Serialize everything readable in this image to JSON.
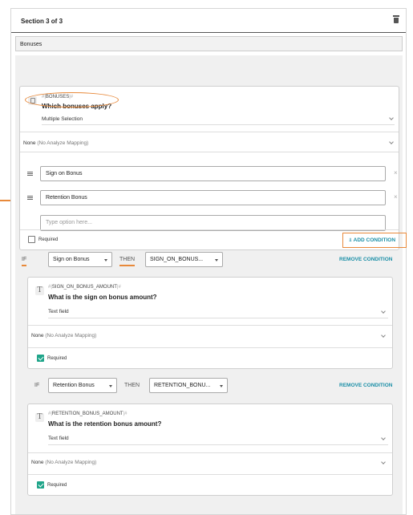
{
  "header": {
    "title": "Section 3 of 3",
    "delete_icon": "trash-icon"
  },
  "section_name": "Bonuses",
  "question1": {
    "icon": "checkbox-question-icon",
    "var_prefix": "#|",
    "var_name": "BONUSES",
    "var_suffix": "|#",
    "text": "Which bonuses apply?",
    "type": "Multiple Selection",
    "mapping_value": "None",
    "mapping_note": "(No Analyze Mapping)",
    "options": [
      "Sign on Bonus",
      "Retention Bonus"
    ],
    "new_option_placeholder": "Type option here...",
    "remove_icon": "×",
    "required_label": "Required",
    "add_condition_label": "ADD CONDITION"
  },
  "conditions": [
    {
      "if_label": "IF",
      "if_value": "Sign on Bonus",
      "then_label": "THEN",
      "then_value": "SIGN_ON_BONUS...",
      "remove_label": "REMOVE CONDITION",
      "question": {
        "icon": "text-question-icon",
        "var_prefix": "#|",
        "var_name": "SIGN_ON_BONUS_AMOUNT",
        "var_suffix": "|#",
        "text": "What is the sign on bonus amount?",
        "type": "Text field",
        "mapping_value": "None",
        "mapping_note": "(No Analyze Mapping)",
        "required_label": "Required",
        "required": true
      }
    },
    {
      "if_label": "IF",
      "if_value": "Retention Bonus",
      "then_label": "THEN",
      "then_value": "RETENTION_BONU...",
      "remove_label": "REMOVE CONDITION",
      "question": {
        "icon": "text-question-icon",
        "var_prefix": "#|",
        "var_name": "RETENTION_BONUS_AMOUNT",
        "var_suffix": "|#",
        "text": "What is the retention bonus amount?",
        "type": "Text field",
        "mapping_value": "None",
        "mapping_note": "(No Analyze Mapping)",
        "required_label": "Required",
        "required": true
      }
    }
  ],
  "colors": {
    "accent": "#e8893a",
    "link": "#1b8fa7",
    "check": "#20a58a"
  }
}
